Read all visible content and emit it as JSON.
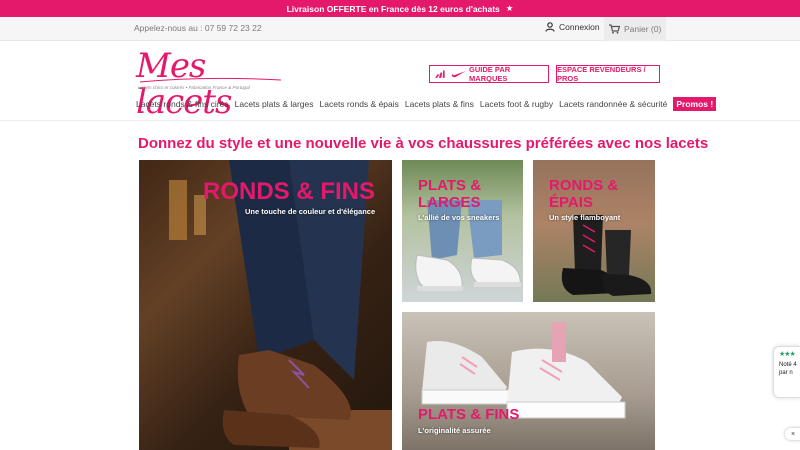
{
  "promo_bar": {
    "text": "Livraison OFFERTE en France dès 12 euros d'achats",
    "icon": "star-icon"
  },
  "topbar": {
    "phone": "Appelez-nous au : 07 59 72 23 22",
    "login": "Connexion",
    "cart": "Panier (0)"
  },
  "logo": {
    "text": "Mes lacets",
    "tagline": "Lacets chics et colorés • Fabrication France & Portugal"
  },
  "header_buttons": {
    "brands": "GUIDE PAR MARQUES",
    "resellers": "ESPACE REVENDEURS / PROS"
  },
  "nav": {
    "items": [
      "Lacets ronds & fins cirés",
      "Lacets plats & larges",
      "Lacets ronds & épais",
      "Lacets plats & fins",
      "Lacets foot & rugby",
      "Lacets randonnée & sécurité"
    ],
    "promo": "Promos !"
  },
  "headline": "Donnez du style et une nouvelle vie à vos chaussures préférées avec nos lacets",
  "tiles": [
    {
      "title": "RONDS & FINS",
      "subtitle": "Une touche de couleur et d'élégance"
    },
    {
      "title_line1": "PLATS &",
      "title_line2": "LARGES",
      "subtitle": "L'allié de vos sneakers"
    },
    {
      "title_line1": "RONDS &",
      "title_line2": "ÉPAIS",
      "subtitle": "Un style flamboyant"
    },
    {
      "title": "PLATS & FINS",
      "subtitle": "L'originalité assurée"
    }
  ],
  "review_widget": {
    "stars": "★★★",
    "line1": "Noté 4",
    "line2": "par n",
    "close": "×"
  },
  "colors": {
    "brand": "#e5196b"
  }
}
